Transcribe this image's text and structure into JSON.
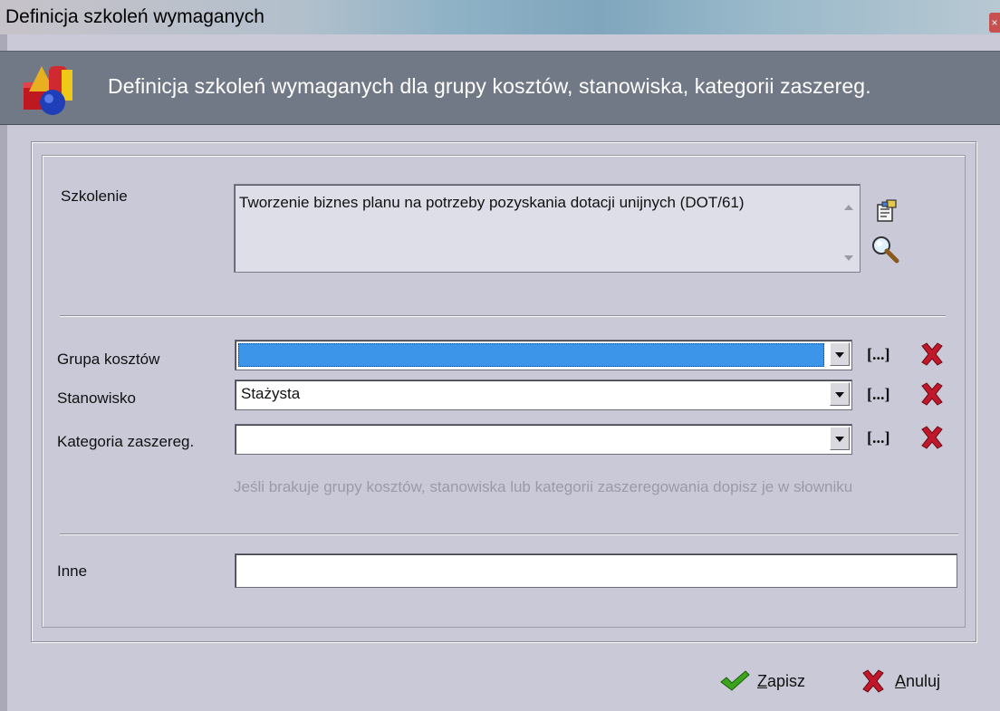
{
  "window": {
    "title": "Definicja szkoleń wymaganych",
    "close_icon": "close-icon"
  },
  "header": {
    "text": "Definicja szkoleń wymaganych dla grupy kosztów, stanowiska, kategorii zaszereg.",
    "logo_icon": "shapes-logo-icon"
  },
  "form": {
    "szkolenie": {
      "label": "Szkolenie",
      "value": "Tworzenie biznes planu na potrzeby pozyskania dotacji unijnych (DOT/61)"
    },
    "grupa_kosztow": {
      "label": "Grupa kosztów",
      "value": ""
    },
    "stanowisko": {
      "label": "Stanowisko",
      "value": "Stażysta"
    },
    "kategoria": {
      "label": "Kategoria zaszereg.",
      "value": ""
    },
    "browse_label": "[...]",
    "hint": "Jeśli brakuje grupy kosztów, stanowiska lub kategorii zaszeregowania dopisz je w słowniku",
    "inne": {
      "label": "Inne",
      "value": ""
    }
  },
  "buttons": {
    "save": {
      "prefix": "",
      "accel": "Z",
      "rest": "apisz"
    },
    "cancel": {
      "prefix": "",
      "accel": "A",
      "rest": "nuluj"
    }
  },
  "colors": {
    "header_bg": "#727986",
    "window_bg": "#c9c9d8",
    "selection": "#3d95ea",
    "delete_red": "#c0182a",
    "save_green": "#3aa51c"
  }
}
